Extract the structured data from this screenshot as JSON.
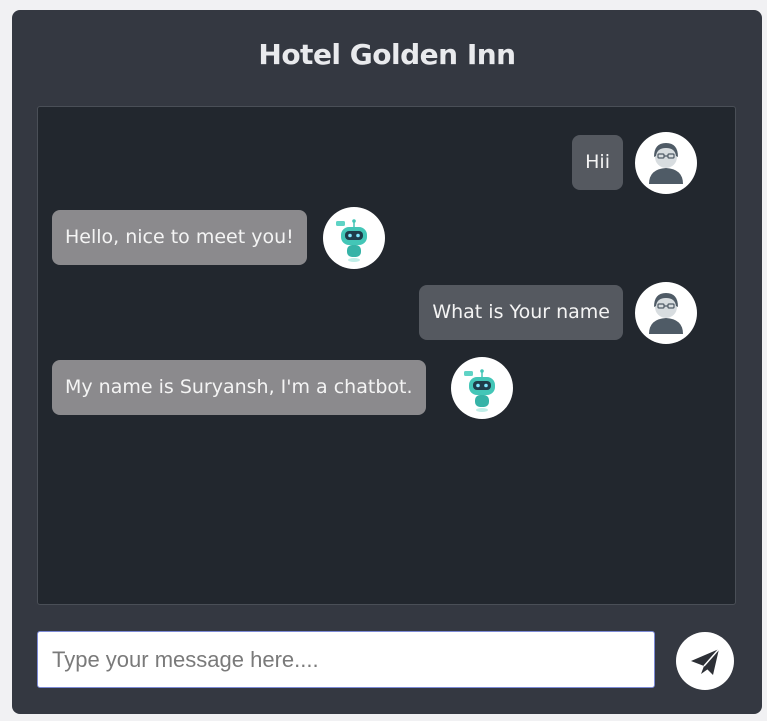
{
  "header": {
    "title": "Hotel Golden Inn"
  },
  "messages": [
    {
      "sender": "user",
      "text": "Hii",
      "avatar_icon": "user-avatar-icon"
    },
    {
      "sender": "bot",
      "text": "Hello, nice to meet you!",
      "avatar_icon": "robot-avatar-icon"
    },
    {
      "sender": "user",
      "text": "What is Your name",
      "avatar_icon": "user-avatar-icon"
    },
    {
      "sender": "bot",
      "text": "My name is Suryansh, I'm a chatbot.",
      "avatar_icon": "robot-avatar-icon"
    }
  ],
  "composer": {
    "placeholder": "Type your message here....",
    "value": "",
    "send_icon": "paper-plane-icon"
  },
  "colors": {
    "card_bg": "#343841",
    "chat_bg": "#22272e",
    "user_bubble": "#555960",
    "bot_bubble": "#8b8a8d",
    "input_border": "#7c8ad6"
  }
}
